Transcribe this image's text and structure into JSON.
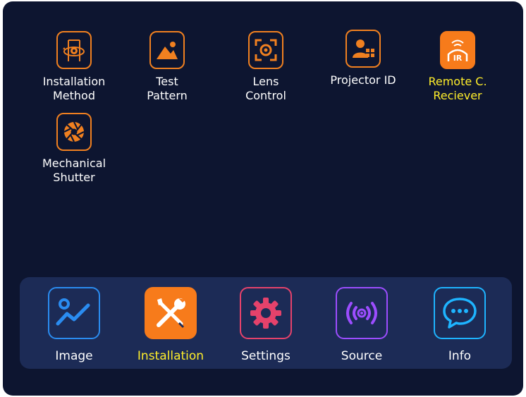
{
  "menu_items": [
    {
      "label": "Installation\nMethod",
      "icon": "rotation-gear-icon"
    },
    {
      "label": "Test\nPattern",
      "icon": "image-mountain-icon"
    },
    {
      "label": "Lens\nControl",
      "icon": "lens-focus-icon"
    },
    {
      "label": "Projector ID",
      "icon": "id-card-icon"
    },
    {
      "label": "Remote C.\nReciever",
      "icon": "ir-receiver-icon",
      "active": true
    },
    {
      "label": "Mechanical\nShutter",
      "icon": "shutter-icon"
    }
  ],
  "dock": [
    {
      "label": "Image",
      "icon": "chart-line-icon",
      "color": "#2a8cf0"
    },
    {
      "label": "Installation",
      "icon": "tools-icon",
      "color": "#f77b1b",
      "active": true
    },
    {
      "label": "Settings",
      "icon": "gear-icon",
      "color": "#e5426b"
    },
    {
      "label": "Source",
      "icon": "signal-icon",
      "color": "#9c4dff"
    },
    {
      "label": "Info",
      "icon": "chat-bubble-icon",
      "color": "#1eb4ff"
    }
  ],
  "colors": {
    "background": "#0d1530",
    "dock_background": "#1c2b56",
    "accent_orange": "#f77b1b",
    "active_text": "#ffee2a"
  }
}
